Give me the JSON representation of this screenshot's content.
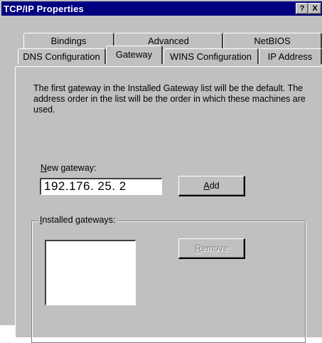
{
  "window": {
    "title": "TCP/IP Properties",
    "help_label": "?",
    "close_label": "X"
  },
  "tabs": {
    "row1": [
      {
        "label": "Bindings"
      },
      {
        "label": "Advanced"
      },
      {
        "label": "NetBIOS"
      }
    ],
    "row2": [
      {
        "label": "DNS Configuration"
      },
      {
        "label": "Gateway",
        "active": true
      },
      {
        "label": "WINS Configuration"
      },
      {
        "label": "IP Address"
      }
    ]
  },
  "gateway": {
    "description": "The first gateway in the Installed Gateway list will be the default. The address order in the list will be the order in which these machines are used.",
    "new_gateway_label_accel": "N",
    "new_gateway_label_rest": "ew gateway:",
    "new_gateway_value": "192.176. 25. 2",
    "add_button_accel": "A",
    "add_button_rest": "dd",
    "installed_label_accel": "I",
    "installed_label_rest": "nstalled gateways:",
    "installed_items": [],
    "remove_button_accel": "R",
    "remove_button_rest": "emove"
  },
  "colors": {
    "titlebar": "#000080",
    "face": "#c0c0c0",
    "disabled_text": "#808080"
  }
}
